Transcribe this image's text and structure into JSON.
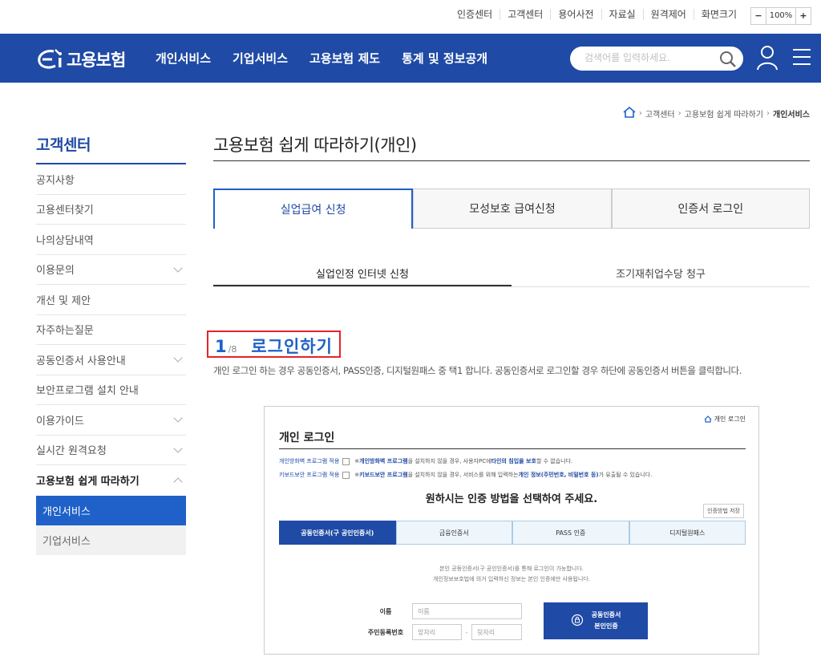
{
  "util": {
    "links": [
      "인증센터",
      "고객센터",
      "용어사전",
      "자료실",
      "원격제어",
      "화면크기"
    ],
    "zoom_minus": "−",
    "zoom_value": "100%",
    "zoom_plus": "+"
  },
  "header": {
    "logo_text": "고용보험",
    "menu": [
      "개인서비스",
      "기업서비스",
      "고용보험 제도",
      "통계 및 정보공개"
    ],
    "search_placeholder": "검색어를 입력하세요."
  },
  "breadcrumb": [
    "고객센터",
    "고용보험 쉽게 따라하기",
    "개인서비스"
  ],
  "sidebar": {
    "title": "고객센터",
    "items": [
      {
        "label": "공지사항",
        "expandable": false
      },
      {
        "label": "고용센터찾기",
        "expandable": false
      },
      {
        "label": "나의상담내역",
        "expandable": false
      },
      {
        "label": "이용문의",
        "expandable": true
      },
      {
        "label": "개선 및 제안",
        "expandable": false
      },
      {
        "label": "자주하는질문",
        "expandable": false
      },
      {
        "label": "공동인증서 사용안내",
        "expandable": true
      },
      {
        "label": "보안프로그램 설치 안내",
        "expandable": false
      },
      {
        "label": "이용가이드",
        "expandable": true
      },
      {
        "label": "실시간 원격요청",
        "expandable": true
      },
      {
        "label": "고용보험 쉽게 따라하기",
        "expandable": true
      }
    ],
    "subitems": [
      "개인서비스",
      "기업서비스"
    ]
  },
  "main": {
    "title": "고용보험 쉽게 따라하기(개인)",
    "tabs": [
      "실업급여 신청",
      "모성보호 급여신청",
      "인증서 로그인"
    ],
    "subtabs": [
      "실업인정 인터넷 신청",
      "조기재취업수당 청구"
    ],
    "step": {
      "num": "1",
      "total": "/8",
      "label": "로그인하기"
    },
    "description": "개인 로그인 하는 경우 공동인증서, PASS인증, 디지털원패스 중 택1 합니다. 공동인증서로 로그인할 경우 하단에 공동인증서 버튼을 클릭합니다."
  },
  "screenshot": {
    "home_label": "개인 로그인",
    "title": "개인 로그인",
    "opt1_label": "개인방화벽 프로그램 적용",
    "opt1_note_a": "※ ",
    "opt1_note_b": "개인방화벽 프로그램",
    "opt1_note_c": "을 설치하지 않을 경우, 사용자PC에 ",
    "opt1_note_d": "타인의 침입을 보호",
    "opt1_note_e": "할 수 없습니다.",
    "opt2_label": "키보드보안 프로그램 적용",
    "opt2_note_a": "※ ",
    "opt2_note_b": "키보드보안 프로그램",
    "opt2_note_c": "을 설치하지 않을 경우, 서비스를 위해 입력하는 ",
    "opt2_note_d": "개인 정보(주민번호, 비밀번호 등)",
    "opt2_note_e": "가 유출될 수 있습니다.",
    "choose": "원하시는 인증 방법을 선택하여 주세요.",
    "save_method": "인증방법 저장",
    "methods": [
      "공동인증서(구 공인인증서)",
      "금융인증서",
      "PASS 인증",
      "디지털원패스"
    ],
    "info1": "본인 공동인증서(구 공인인증서)를 통해 로그인이 가능합니다.",
    "info2": "개인정보보호법에 의거 입력하신 정보는 본인 인증에만 사용됩니다.",
    "name_label": "이름",
    "name_placeholder": "이름",
    "rrn_label": "주민등록번호",
    "rrn_front": "앞자리",
    "rrn_dash": "-",
    "rrn_back": "뒷자리",
    "cert_btn_line1": "공동인증서",
    "cert_btn_line2": "본인인증"
  }
}
